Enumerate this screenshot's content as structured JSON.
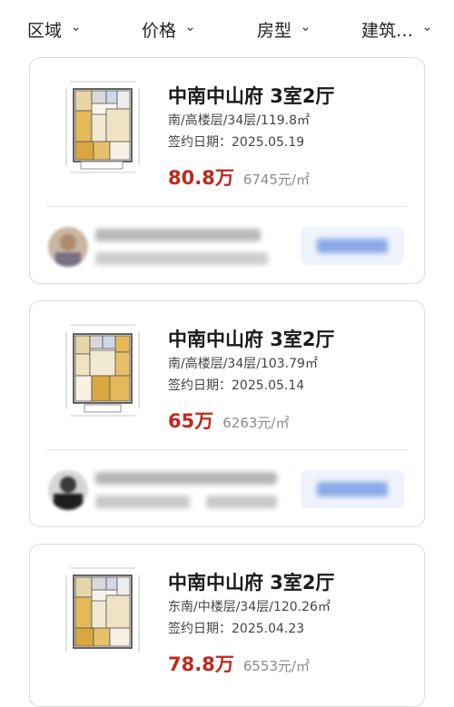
{
  "filters": [
    {
      "label": "区域"
    },
    {
      "label": "价格"
    },
    {
      "label": "房型"
    },
    {
      "label": "建筑…"
    }
  ],
  "listings": [
    {
      "title": "中南中山府 3室2厅",
      "details": "南/高楼层/34层/119.8㎡",
      "sign_date": "签约日期：2025.05.19",
      "price": "80.8万",
      "unit_price": "6745元/㎡",
      "thumbnail_icon": "floor-plan-icon",
      "agent_avatar_icon": "avatar-icon"
    },
    {
      "title": "中南中山府 3室2厅",
      "details": "南/高楼层/34层/103.79㎡",
      "sign_date": "签约日期：2025.05.14",
      "price": "65万",
      "unit_price": "6263元/㎡",
      "thumbnail_icon": "floor-plan-icon",
      "agent_avatar_icon": "avatar-icon"
    },
    {
      "title": "中南中山府 3室2厅",
      "details": "东南/中楼层/34层/120.26㎡",
      "sign_date": "签约日期：2025.04.23",
      "price": "78.8万",
      "unit_price": "6553元/㎡",
      "thumbnail_icon": "floor-plan-icon",
      "agent_avatar_icon": "avatar-icon"
    }
  ],
  "colors": {
    "price_red": "#c3271c",
    "contact_button_bg": "#eef3fc",
    "card_border": "#dcdcdc"
  }
}
